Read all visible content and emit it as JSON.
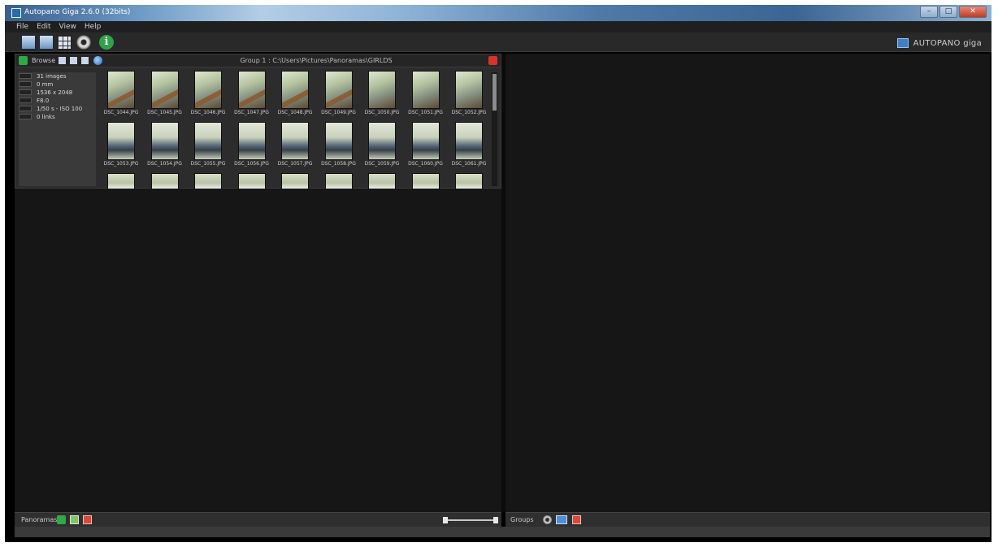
{
  "window": {
    "title": "Autopano Giga 2.6.0 (32bits)",
    "controls": {
      "minimize": "–",
      "maximize": "□",
      "close": "✕"
    }
  },
  "menu": [
    "File",
    "Edit",
    "View",
    "Help"
  ],
  "toolbar": {
    "icons": [
      "open-images-icon",
      "open-folder-icon",
      "grid-view-icon",
      "settings-gear-icon",
      "info-icon"
    ],
    "brand": "AUTOPANO giga"
  },
  "browser": {
    "label": "Browse",
    "path": "Group 1 : C:\\Users\\Pictures\\Panoramas\\GIRLDS",
    "info": [
      "31 images",
      "0 mm",
      "1536 x 2048",
      "F8.0",
      "1/50 s - ISO 100",
      "0 links"
    ],
    "thumbnails": [
      {
        "caption": "DSC_1044.JPG",
        "style": "stripe"
      },
      {
        "caption": "DSC_1045.JPG",
        "style": "stripe"
      },
      {
        "caption": "DSC_1046.JPG",
        "style": "stripe"
      },
      {
        "caption": "DSC_1047.JPG",
        "style": "stripe"
      },
      {
        "caption": "DSC_1048.JPG",
        "style": "stripe"
      },
      {
        "caption": "DSC_1049.JPG",
        "style": "stripe"
      },
      {
        "caption": "DSC_1050.JPG",
        "style": "plain"
      },
      {
        "caption": "DSC_1051.JPG",
        "style": "plain"
      },
      {
        "caption": "DSC_1052.JPG",
        "style": "plain"
      },
      {
        "caption": "DSC_1053.JPG",
        "style": "row2"
      },
      {
        "caption": "DSC_1054.JPG",
        "style": "row2"
      },
      {
        "caption": "DSC_1055.JPG",
        "style": "row2"
      },
      {
        "caption": "DSC_1056.JPG",
        "style": "row2"
      },
      {
        "caption": "DSC_1057.JPG",
        "style": "row2"
      },
      {
        "caption": "DSC_1058.JPG",
        "style": "row2"
      },
      {
        "caption": "DSC_1059.JPG",
        "style": "row2"
      },
      {
        "caption": "DSC_1060.JPG",
        "style": "row2"
      },
      {
        "caption": "DSC_1061.JPG",
        "style": "row2"
      },
      {
        "caption": "",
        "style": "row3"
      },
      {
        "caption": "",
        "style": "row3"
      },
      {
        "caption": "",
        "style": "row3"
      },
      {
        "caption": "",
        "style": "row3"
      },
      {
        "caption": "",
        "style": "row3"
      },
      {
        "caption": "",
        "style": "row3"
      },
      {
        "caption": "",
        "style": "row3"
      },
      {
        "caption": "",
        "style": "row3"
      },
      {
        "caption": "",
        "style": "row3"
      }
    ]
  },
  "bottom_left": {
    "label": "Panoramas"
  },
  "bottom_right": {
    "label": "Groups"
  },
  "colors": {
    "accent_green": "#2faa47",
    "accent_red": "#d94a3a",
    "background": "#161616"
  }
}
